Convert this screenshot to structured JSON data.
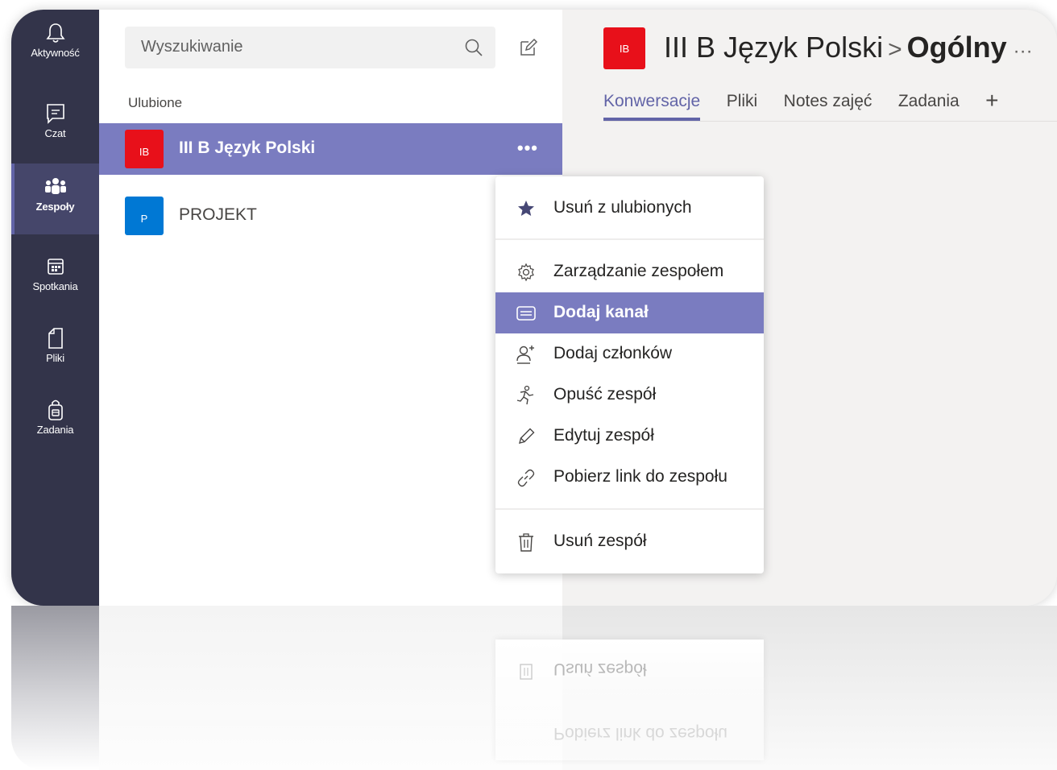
{
  "rail": {
    "items": [
      {
        "label": "Aktywność",
        "icon": "bell-icon"
      },
      {
        "label": "Czat",
        "icon": "chat-icon"
      },
      {
        "label": "Zespoły",
        "icon": "teams-icon"
      },
      {
        "label": "Spotkania",
        "icon": "calendar-icon"
      },
      {
        "label": "Pliki",
        "icon": "file-icon"
      },
      {
        "label": "Zadania",
        "icon": "assignments-icon"
      }
    ],
    "active": "Zespoły"
  },
  "sidebar": {
    "search_placeholder": "Wyszukiwanie",
    "section_label": "Ulubione",
    "teams": [
      {
        "avatar": "IB",
        "name": "III B Język Polski",
        "avatar_color": "#e8101a"
      },
      {
        "avatar": "P",
        "name": "PROJEKT",
        "avatar_color": "#0078d4"
      }
    ],
    "more_label": "•••"
  },
  "header": {
    "avatar": "IB",
    "team": "III B Język Polski",
    "separator": ">",
    "channel": "Ogólny",
    "more": "···"
  },
  "tabs": {
    "items": [
      "Konwersacje",
      "Pliki",
      "Notes zajęć",
      "Zadania"
    ],
    "add": "+"
  },
  "menu": {
    "items": [
      {
        "label": "Usuń z ulubionych",
        "icon": "star-icon"
      },
      {
        "label": "Zarządzanie zespołem",
        "icon": "gear-icon"
      },
      {
        "label": "Dodaj kanał",
        "icon": "channel-icon"
      },
      {
        "label": "Dodaj członków",
        "icon": "add-member-icon"
      },
      {
        "label": "Opuść zespół",
        "icon": "leave-icon"
      },
      {
        "label": "Edytuj zespół",
        "icon": "pencil-icon"
      },
      {
        "label": "Pobierz link do zespołu",
        "icon": "link-icon"
      },
      {
        "label": "Usuń zespół",
        "icon": "trash-icon"
      }
    ],
    "highlighted": "Dodaj kanał"
  },
  "colors": {
    "rail_bg": "#33344a",
    "accent": "#6264a7",
    "highlight": "#7a7cc0",
    "avatar_red": "#e8101a",
    "avatar_blue": "#0078d4"
  }
}
